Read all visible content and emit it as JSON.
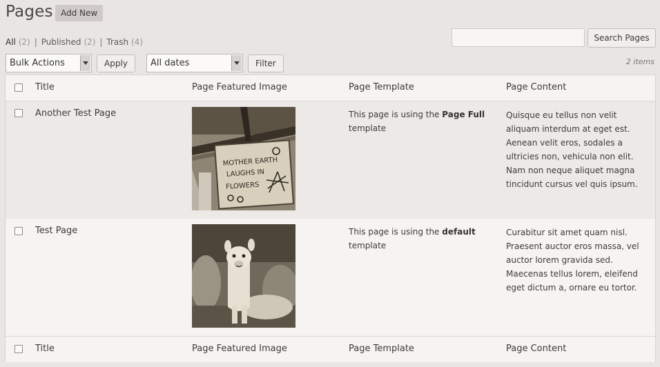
{
  "header": {
    "title": "Pages",
    "add_new_label": "Add New"
  },
  "views": [
    {
      "label": "All",
      "count": "(2)"
    },
    {
      "label": "Published",
      "count": "(2)"
    },
    {
      "label": "Trash",
      "count": "(4)"
    }
  ],
  "views_separator": "|",
  "search": {
    "value": "",
    "button_label": "Search Pages"
  },
  "tablenav": {
    "bulk_actions": "Bulk Actions",
    "apply_label": "Apply",
    "dates_filter": "All dates",
    "filter_label": "Filter",
    "items_count": "2 items"
  },
  "table": {
    "columns": [
      "Title",
      "Page Featured Image",
      "Page Template",
      "Page Content"
    ],
    "rows": [
      {
        "title": "Another Test Page",
        "template_prefix": "This page is using the",
        "template_name": "Page Full",
        "template_suffix": "template",
        "image_icon": "sign-mother-earth-image",
        "image_text": [
          "MOTHER EARTH",
          "LAUGHS IN",
          "FLOWERS"
        ],
        "content": "Quisque eu tellus non velit aliquam interdum at eget est. Aenean velit eros, sodales a ultricies non, vehicula non elit. Nam non neque aliquet magna tincidunt cursus vel quis ipsum."
      },
      {
        "title": "Test Page",
        "template_prefix": "This page is using the",
        "template_name": "default",
        "template_suffix": "template",
        "image_icon": "alpaca-image",
        "content": "Curabitur sit amet quam nisl. Praesent auctor eros massa, vel auctor lorem gravida sed. Maecenas tellus lorem, eleifend eget dictum a, ornare eu tortor."
      }
    ]
  },
  "colors": {
    "background": "#e9e5e3",
    "table_bg": "#f6f4f3",
    "alt_row": "#ece9e7",
    "text": "#3d3a3a"
  }
}
